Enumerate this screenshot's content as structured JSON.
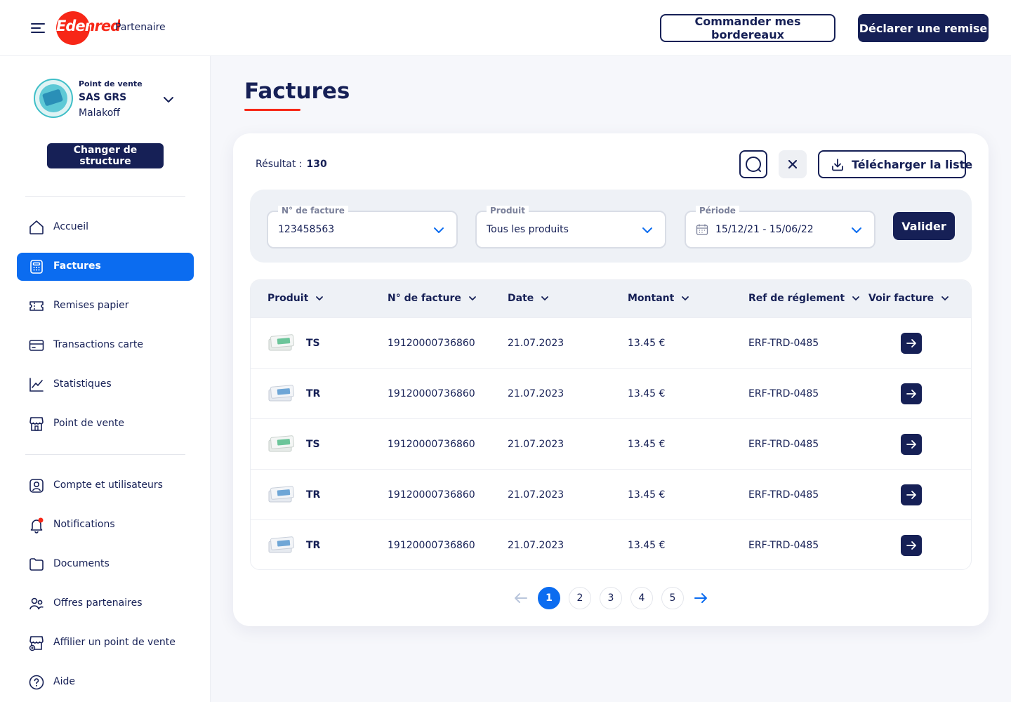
{
  "header": {
    "logo_main": "Edenred",
    "logo_sub": "Partenaire",
    "btn_order": "Commander mes bordereaux",
    "btn_declare": "Déclarer une remise"
  },
  "sidebar": {
    "pos_label": "Point de vente",
    "pos_name": "SAS GRS",
    "pos_city": "Malakoff",
    "btn_change": "Changer de structure",
    "nav_main": [
      {
        "label": "Accueil",
        "icon": "home-icon"
      },
      {
        "label": "Factures",
        "icon": "invoice-icon",
        "active": true
      },
      {
        "label": "Remises papier",
        "icon": "ticket-icon"
      },
      {
        "label": "Transactions carte",
        "icon": "card-icon"
      },
      {
        "label": "Statistiques",
        "icon": "chart-icon"
      },
      {
        "label": "Point de vente",
        "icon": "store-icon"
      }
    ],
    "nav_secondary": [
      {
        "label": "Compte et utilisateurs",
        "icon": "user-icon"
      },
      {
        "label": "Notifications",
        "icon": "bell-icon"
      },
      {
        "label": "Documents",
        "icon": "folder-icon"
      },
      {
        "label": "Offres partenaires",
        "icon": "users-icon"
      },
      {
        "label": "Affilier un point de vente",
        "icon": "store-add-icon"
      },
      {
        "label": "Aide",
        "icon": "help-icon"
      }
    ]
  },
  "main": {
    "title": "Factures",
    "result_label": "Résultat :",
    "result_count": "130",
    "btn_download": "Télécharger la liste",
    "filters": {
      "invoice_label": "N° de facture",
      "invoice_value": "123458563",
      "product_label": "Produit",
      "product_value": "Tous les produits",
      "period_label": "Période",
      "period_value": "15/12/21 - 15/06/22",
      "btn_validate": "Valider"
    },
    "table": {
      "headers": [
        "Produit",
        "N° de facture",
        "Date",
        "Montant",
        "Ref de réglement",
        "Voir facture"
      ],
      "rows": [
        {
          "product": "TS",
          "invoice": "19120000736860",
          "date": "21.07.2023",
          "amount": "13.45 €",
          "ref": "ERF-TRD-0485"
        },
        {
          "product": "TR",
          "invoice": "19120000736860",
          "date": "21.07.2023",
          "amount": "13.45 €",
          "ref": "ERF-TRD-0485"
        },
        {
          "product": "TS",
          "invoice": "19120000736860",
          "date": "21.07.2023",
          "amount": "13.45 €",
          "ref": "ERF-TRD-0485"
        },
        {
          "product": "TR",
          "invoice": "19120000736860",
          "date": "21.07.2023",
          "amount": "13.45 €",
          "ref": "ERF-TRD-0485"
        },
        {
          "product": "TR",
          "invoice": "19120000736860",
          "date": "21.07.2023",
          "amount": "13.45 €",
          "ref": "ERF-TRD-0485"
        }
      ]
    },
    "pagination": {
      "pages": [
        "1",
        "2",
        "3",
        "4",
        "5"
      ],
      "current": "1"
    }
  },
  "colors": {
    "navy": "#162056",
    "brand_red": "#f72717",
    "active_blue": "#0b6cf0",
    "background": "#f6f7fb"
  }
}
